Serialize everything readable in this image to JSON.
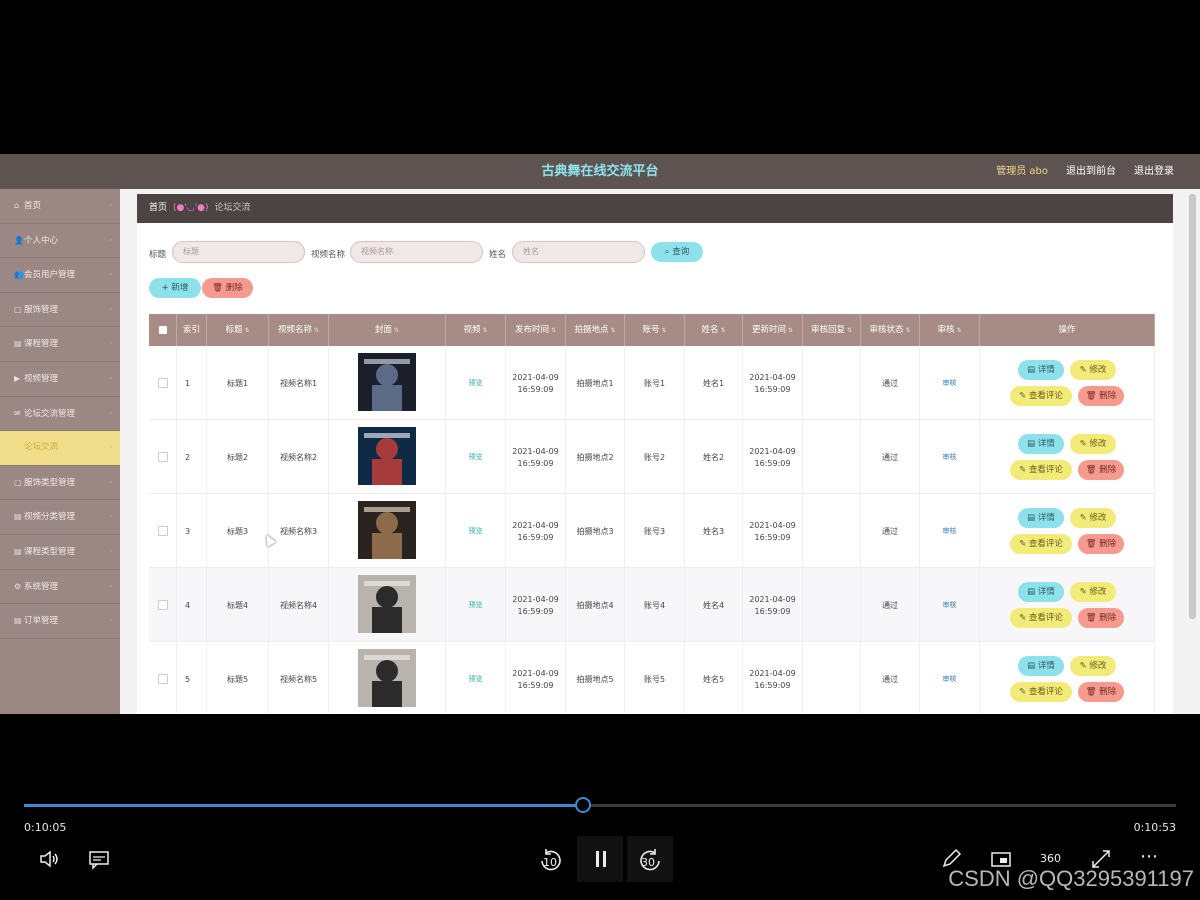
{
  "header": {
    "title": "古典舞在线交流平台",
    "user": "管理员 abo",
    "back_front": "退出到前台",
    "logout": "退出登录"
  },
  "sidebar": {
    "items": [
      {
        "label": "首页"
      },
      {
        "label": "个人中心"
      },
      {
        "label": "会员用户管理"
      },
      {
        "label": "服饰管理"
      },
      {
        "label": "课程管理"
      },
      {
        "label": "视频管理"
      },
      {
        "label": "论坛交流管理"
      },
      {
        "label": "论坛交流"
      },
      {
        "label": "服饰类型管理"
      },
      {
        "label": "视频分类管理"
      },
      {
        "label": "课程类型管理"
      },
      {
        "label": "系统管理"
      },
      {
        "label": "订单管理"
      }
    ],
    "active_index": 7
  },
  "breadcrumb": {
    "home": "首页",
    "face": "(●'◡'●)",
    "current": "论坛交流"
  },
  "search": {
    "title_label": "标题",
    "title_placeholder": "标题",
    "video_label": "视频名称",
    "video_placeholder": "视频名称",
    "name_label": "姓名",
    "name_placeholder": "姓名",
    "query": "查询"
  },
  "actions": {
    "add": "新增",
    "delete": "删除"
  },
  "table": {
    "headers": [
      "索引",
      "标题",
      "视频名称",
      "封面",
      "视频",
      "发布时间",
      "拍摄地点",
      "账号",
      "姓名",
      "更新时间",
      "审核回复",
      "审核状态",
      "审核",
      "操作"
    ],
    "rows": [
      {
        "index": "1",
        "title": "标题1",
        "video_name": "视频名称1",
        "video": "预览",
        "publish_date": "2021-04-09",
        "publish_time": "16:59:09",
        "location": "拍摄地点1",
        "account": "账号1",
        "name": "姓名1",
        "update_date": "2021-04-09",
        "update_time": "16:59:09",
        "reply": "",
        "status": "通过",
        "audit": "审核"
      },
      {
        "index": "2",
        "title": "标题2",
        "video_name": "视频名称2",
        "video": "预览",
        "publish_date": "2021-04-09",
        "publish_time": "16:59:09",
        "location": "拍摄地点2",
        "account": "账号2",
        "name": "姓名2",
        "update_date": "2021-04-09",
        "update_time": "16:59:09",
        "reply": "",
        "status": "通过",
        "audit": "审核"
      },
      {
        "index": "3",
        "title": "标题3",
        "video_name": "视频名称3",
        "video": "预览",
        "publish_date": "2021-04-09",
        "publish_time": "16:59:09",
        "location": "拍摄地点3",
        "account": "账号3",
        "name": "姓名3",
        "update_date": "2021-04-09",
        "update_time": "16:59:09",
        "reply": "",
        "status": "通过",
        "audit": "审核"
      },
      {
        "index": "4",
        "title": "标题4",
        "video_name": "视频名称4",
        "video": "预览",
        "publish_date": "2021-04-09",
        "publish_time": "16:59:09",
        "location": "拍摄地点4",
        "account": "账号4",
        "name": "姓名4",
        "update_date": "2021-04-09",
        "update_time": "16:59:09",
        "reply": "",
        "status": "通过",
        "audit": "审核"
      },
      {
        "index": "5",
        "title": "标题5",
        "video_name": "视频名称5",
        "video": "预览",
        "publish_date": "2021-04-09",
        "publish_time": "16:59:09",
        "location": "拍摄地点5",
        "account": "账号5",
        "name": "姓名5",
        "update_date": "2021-04-09",
        "update_time": "16:59:09",
        "reply": "",
        "status": "通过",
        "audit": "审核"
      }
    ],
    "op_labels": {
      "detail": "详情",
      "edit": "修改",
      "comments": "查看评论",
      "delete": "删除"
    }
  },
  "player": {
    "elapsed": "0:10:05",
    "total": "0:10:53",
    "progress": 0.485,
    "rewind": "10",
    "forward": "30",
    "vr": "360"
  },
  "watermark": "CSDN @QQ3295391197"
}
